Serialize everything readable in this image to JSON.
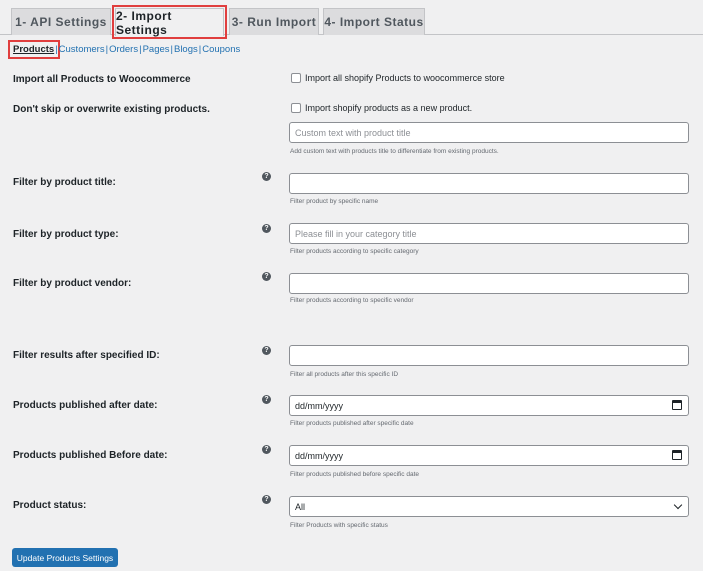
{
  "tabs": [
    {
      "label": "1- API Settings",
      "active": false
    },
    {
      "label": "2- Import Settings",
      "active": true
    },
    {
      "label": "3- Run Import",
      "active": false
    },
    {
      "label": "4- Import Status",
      "active": false
    }
  ],
  "subnav": {
    "items": [
      "Products",
      "Customers",
      "Orders",
      "Pages",
      "Blogs",
      "Coupons"
    ],
    "current": "Products",
    "separator": "|"
  },
  "form": {
    "import_all": {
      "label": "Import all Products to Woocommerce",
      "checkbox_label": "Import all shopify Products to woocommerce store",
      "checked": false
    },
    "no_skip": {
      "label": "Don't skip or overwrite existing products.",
      "checkbox_label": "Import shopify products as a new product.",
      "checked": false
    },
    "custom_text": {
      "placeholder": "Custom text with product title",
      "value": "",
      "description": "Add custom text with products title to differentiate from existing products."
    },
    "filter_title": {
      "label": "Filter by product title:",
      "value": "",
      "placeholder": "",
      "description": "Filter product by specific name"
    },
    "filter_type": {
      "label": "Filter by product type:",
      "value": "",
      "placeholder": "Please fill in your category title",
      "description": "Filter products according to specific category"
    },
    "filter_vendor": {
      "label": "Filter by product vendor:",
      "value": "",
      "placeholder": "",
      "description": "Filter products according to specific vendor"
    },
    "filter_id": {
      "label": "Filter results after specified ID:",
      "value": "",
      "placeholder": "",
      "description": "Filter all products after this specific ID"
    },
    "published_after": {
      "label": "Products published after date:",
      "value": "dd/mm/yyyy",
      "description": "Filter products published after specific date"
    },
    "published_before": {
      "label": "Products published Before date:",
      "value": "dd/mm/yyyy",
      "description": "Filter products published before specific date"
    },
    "status": {
      "label": "Product status:",
      "selected": "All",
      "description": "Filter Products with specific status"
    }
  },
  "help_icon": "?",
  "buttons": {
    "update": "Update Products Settings"
  },
  "colors": {
    "accent": "#2271b1",
    "highlight": "#e03e3e",
    "background": "#f0f0f1"
  }
}
